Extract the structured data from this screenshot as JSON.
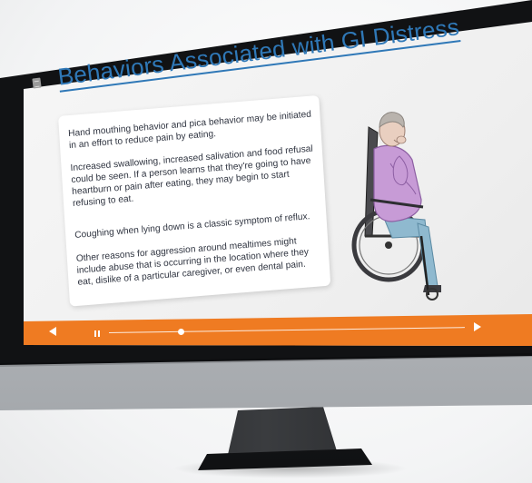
{
  "slide": {
    "title": "Behaviors Associated with GI Distress",
    "paragraphs": [
      "Hand mouthing behavior and pica behavior may be initiated in an effort to reduce pain by eating.",
      "Increased swallowing, increased salivation and food refusal could be seen.  If a person learns that they're going to have heartburn or pain after eating, they may begin to start refusing to eat.",
      "Coughing when lying down is a classic symptom of reflux.",
      "Other reasons for aggression around mealtimes might include abuse that is occurring in the location where they eat, dislike of a particular caregiver, or even dental pain."
    ],
    "illustration_icon": "elderly-woman-in-wheelchair-illustration"
  },
  "player": {
    "menu_icon": "menu-icon",
    "prev_icon": "prev-triangle-icon",
    "pause_icon": "pause-icon",
    "next_icon": "next-triangle-icon",
    "progress": 0.2,
    "accent_color": "#ef7b22",
    "title_color": "#2f78b7"
  }
}
